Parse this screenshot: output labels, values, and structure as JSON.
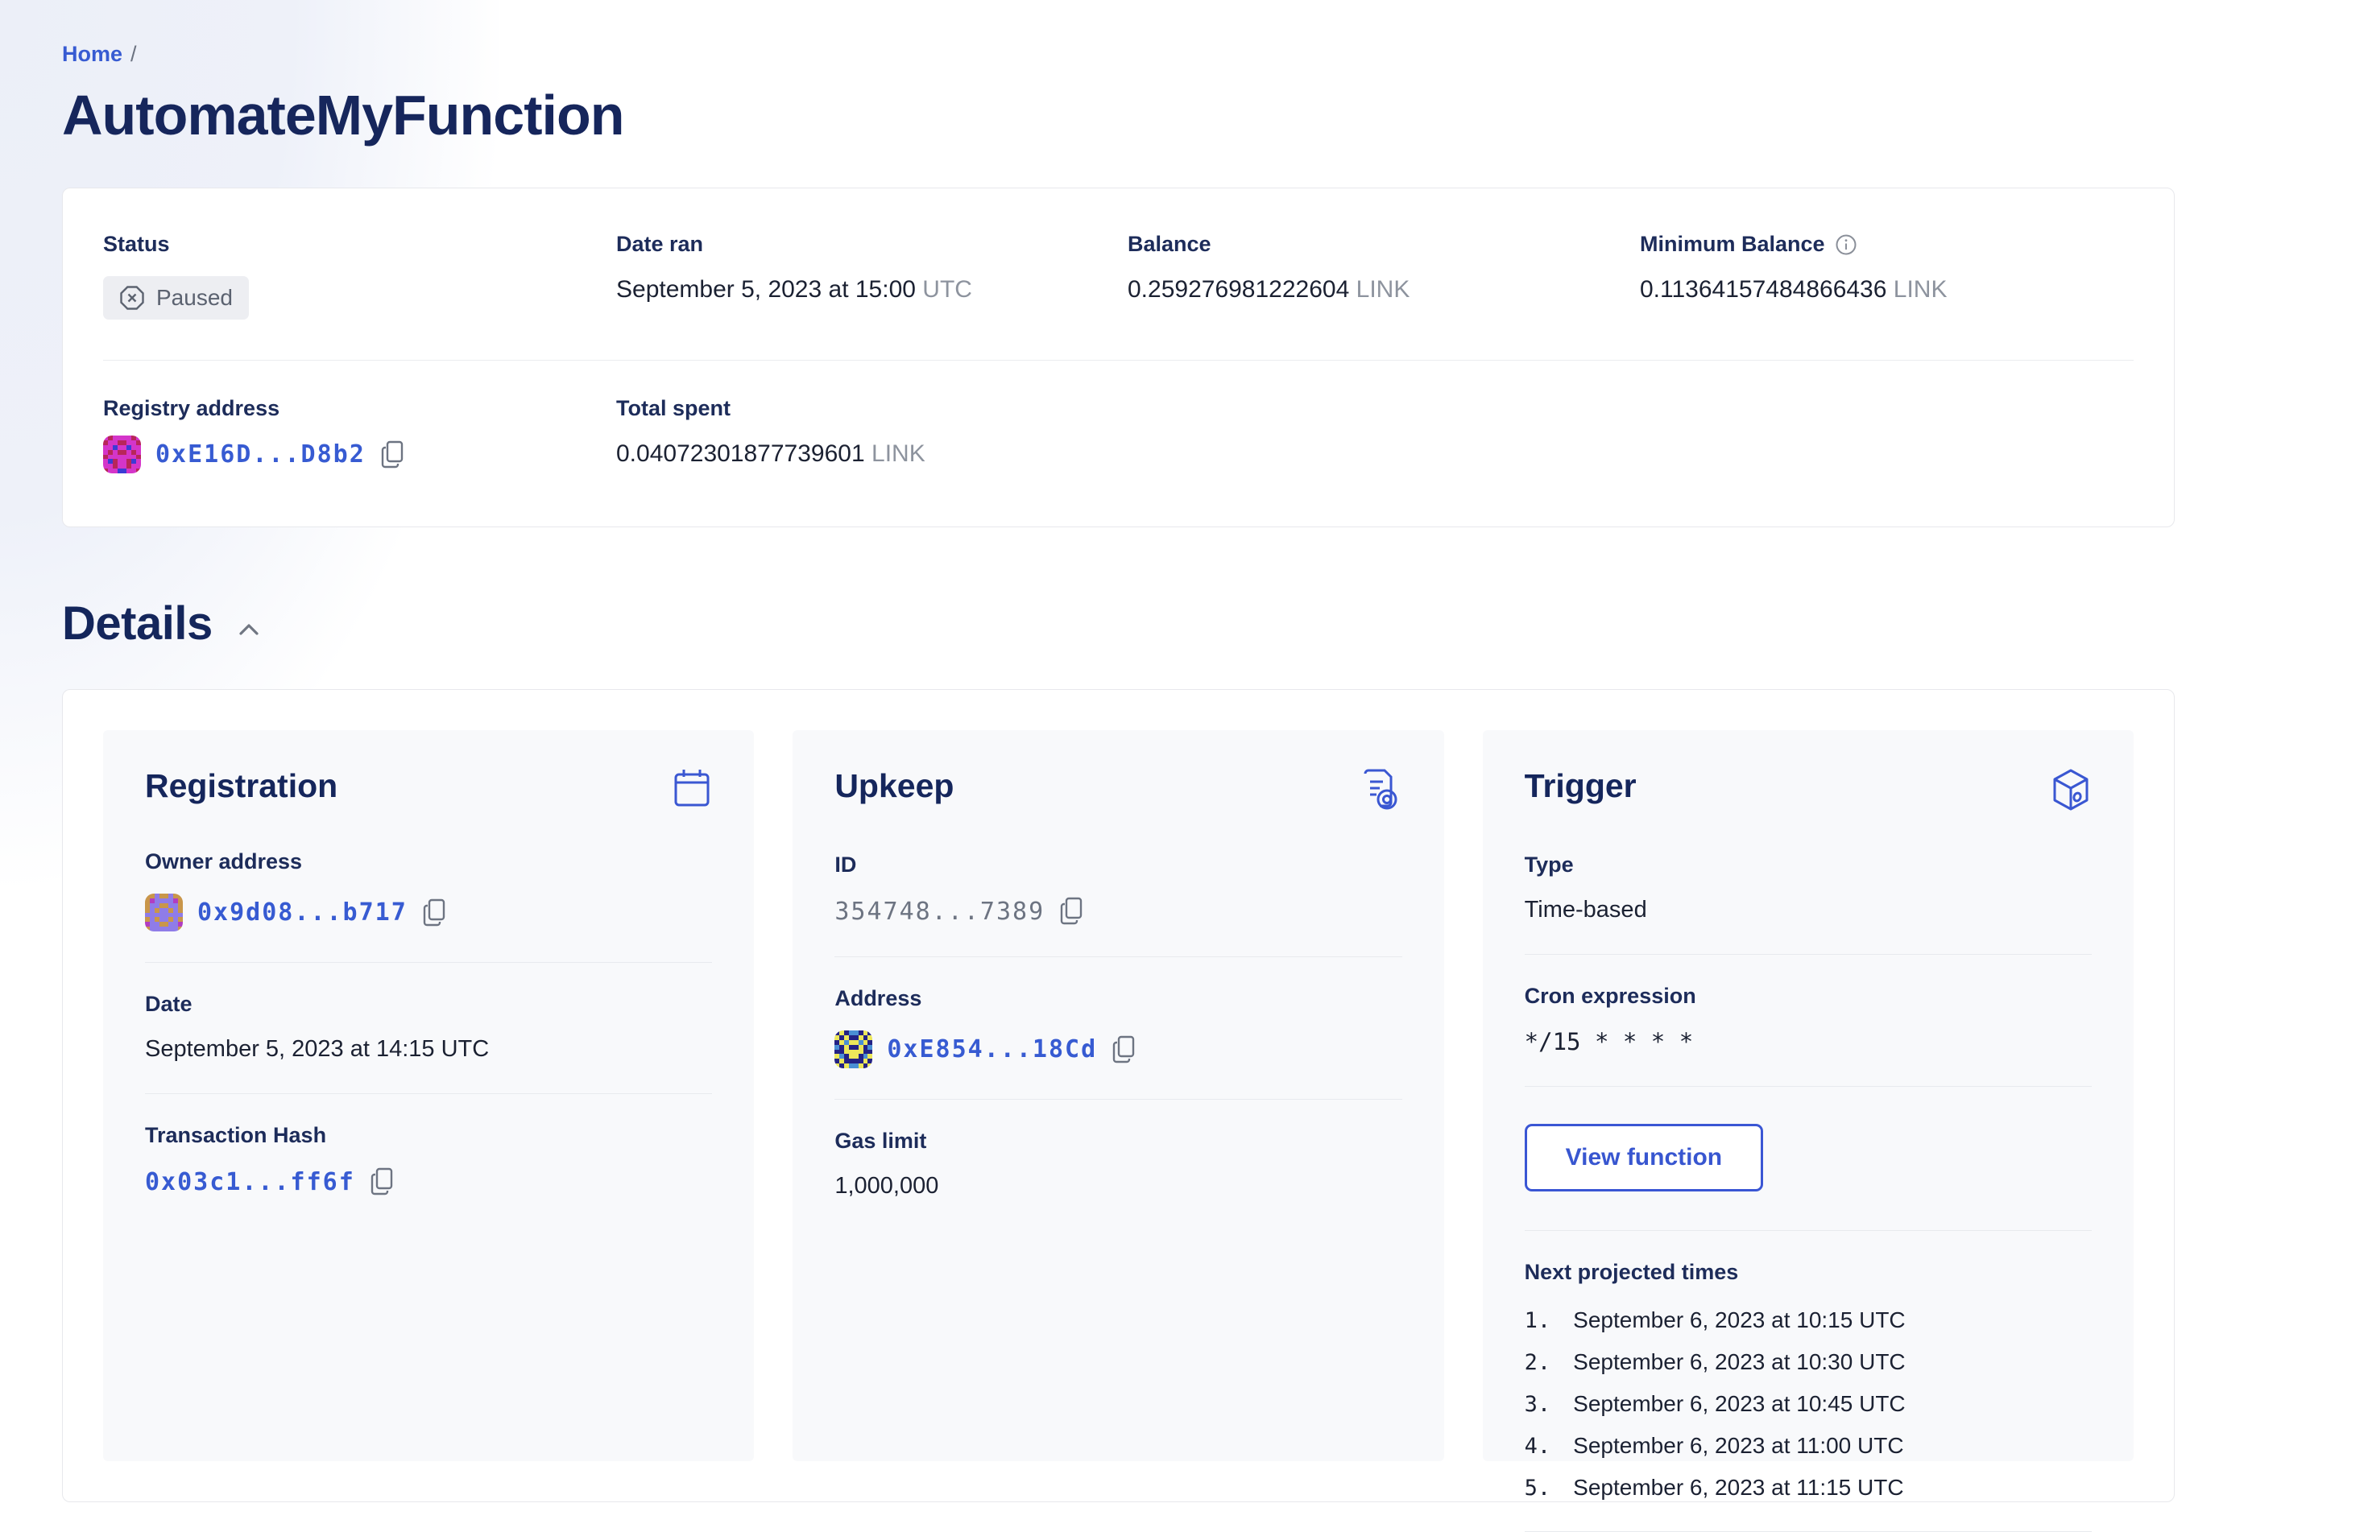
{
  "colors": {
    "accent_blue": "#375bd2",
    "heading_navy": "#16265c",
    "label_navy": "#1d2c5a",
    "muted_gray": "#8d939e",
    "pill_bg": "#edeef2",
    "pill_text": "#5b6270",
    "card_bg": "#f8f9fb"
  },
  "breadcrumb": {
    "home": "Home",
    "separator": "/"
  },
  "page_title": "AutomateMyFunction",
  "summary": {
    "status": {
      "label": "Status",
      "value": "Paused",
      "icon": "octagon-x-icon"
    },
    "date_ran": {
      "label": "Date ran",
      "value": "September 5, 2023 at 15:00",
      "suffix": "UTC"
    },
    "balance": {
      "label": "Balance",
      "value": "0.259276981222604",
      "unit": "LINK"
    },
    "min_balance": {
      "label": "Minimum Balance",
      "value": "0.11364157484866436",
      "unit": "LINK",
      "icon": "info-icon"
    },
    "registry": {
      "label": "Registry address",
      "address": "0xE16D...D8b2"
    },
    "total_spent": {
      "label": "Total spent",
      "value": "0.04072301877739601",
      "unit": "LINK"
    }
  },
  "details": {
    "heading": "Details",
    "registration": {
      "title": "Registration",
      "icon": "calendar-icon",
      "owner": {
        "label": "Owner address",
        "address": "0x9d08...b717"
      },
      "date": {
        "label": "Date",
        "value": "September 5, 2023 at 14:15 UTC"
      },
      "tx": {
        "label": "Transaction Hash",
        "hash": "0x03c1...ff6f"
      }
    },
    "upkeep": {
      "title": "Upkeep",
      "icon": "document-gear-icon",
      "id": {
        "label": "ID",
        "value": "354748...7389"
      },
      "address": {
        "label": "Address",
        "value": "0xE854...18Cd"
      },
      "gas": {
        "label": "Gas limit",
        "value": "1,000,000"
      }
    },
    "trigger": {
      "title": "Trigger",
      "icon": "cube-icon",
      "type": {
        "label": "Type",
        "value": "Time-based"
      },
      "cron": {
        "label": "Cron expression",
        "value": "*/15 * * * *"
      },
      "view_function_label": "View function",
      "next_times": {
        "label": "Next projected times",
        "items": [
          "September 6, 2023 at 10:15 UTC",
          "September 6, 2023 at 10:30 UTC",
          "September 6, 2023 at 10:45 UTC",
          "September 6, 2023 at 11:00 UTC",
          "September 6, 2023 at 11:15 UTC"
        ]
      }
    }
  },
  "identicons": {
    "registry": {
      "palette": {
        "R": "#b8265a",
        "M": "#d435c9",
        "B": "#3c3bd4"
      },
      "grid": [
        "MRMMMMRM",
        "RMMRRMMR",
        "MMBMMBMM",
        "MRMRRMRM",
        "RMMMMMMR",
        "MBRMMRBM",
        "MMRMMRMM",
        "RMMBBMMR"
      ]
    },
    "owner": {
      "palette": {
        "T": "#c9964a",
        "P": "#8f7ce8",
        "G": "#b13dc1"
      },
      "grid": [
        "TTPTTPTT",
        "TGPPPPGT",
        "TPPTTPPT",
        "TPTPPTPT",
        "PPPPPPPP",
        "TPTPPTPT",
        "GPPTTPPG",
        "TPPPPPPT"
      ]
    },
    "upkeep": {
      "palette": {
        "N": "#232285",
        "Y": "#ece75a",
        "L": "#4a8fd4"
      },
      "grid": [
        "NYNLLNYN",
        "YNYNNYNY",
        "NYLYYLYN",
        "LNYNNYNL",
        "NNYYYYNN",
        "YLNYYNLY",
        "NYNNNNYN",
        "YNYLLYNY"
      ]
    }
  }
}
